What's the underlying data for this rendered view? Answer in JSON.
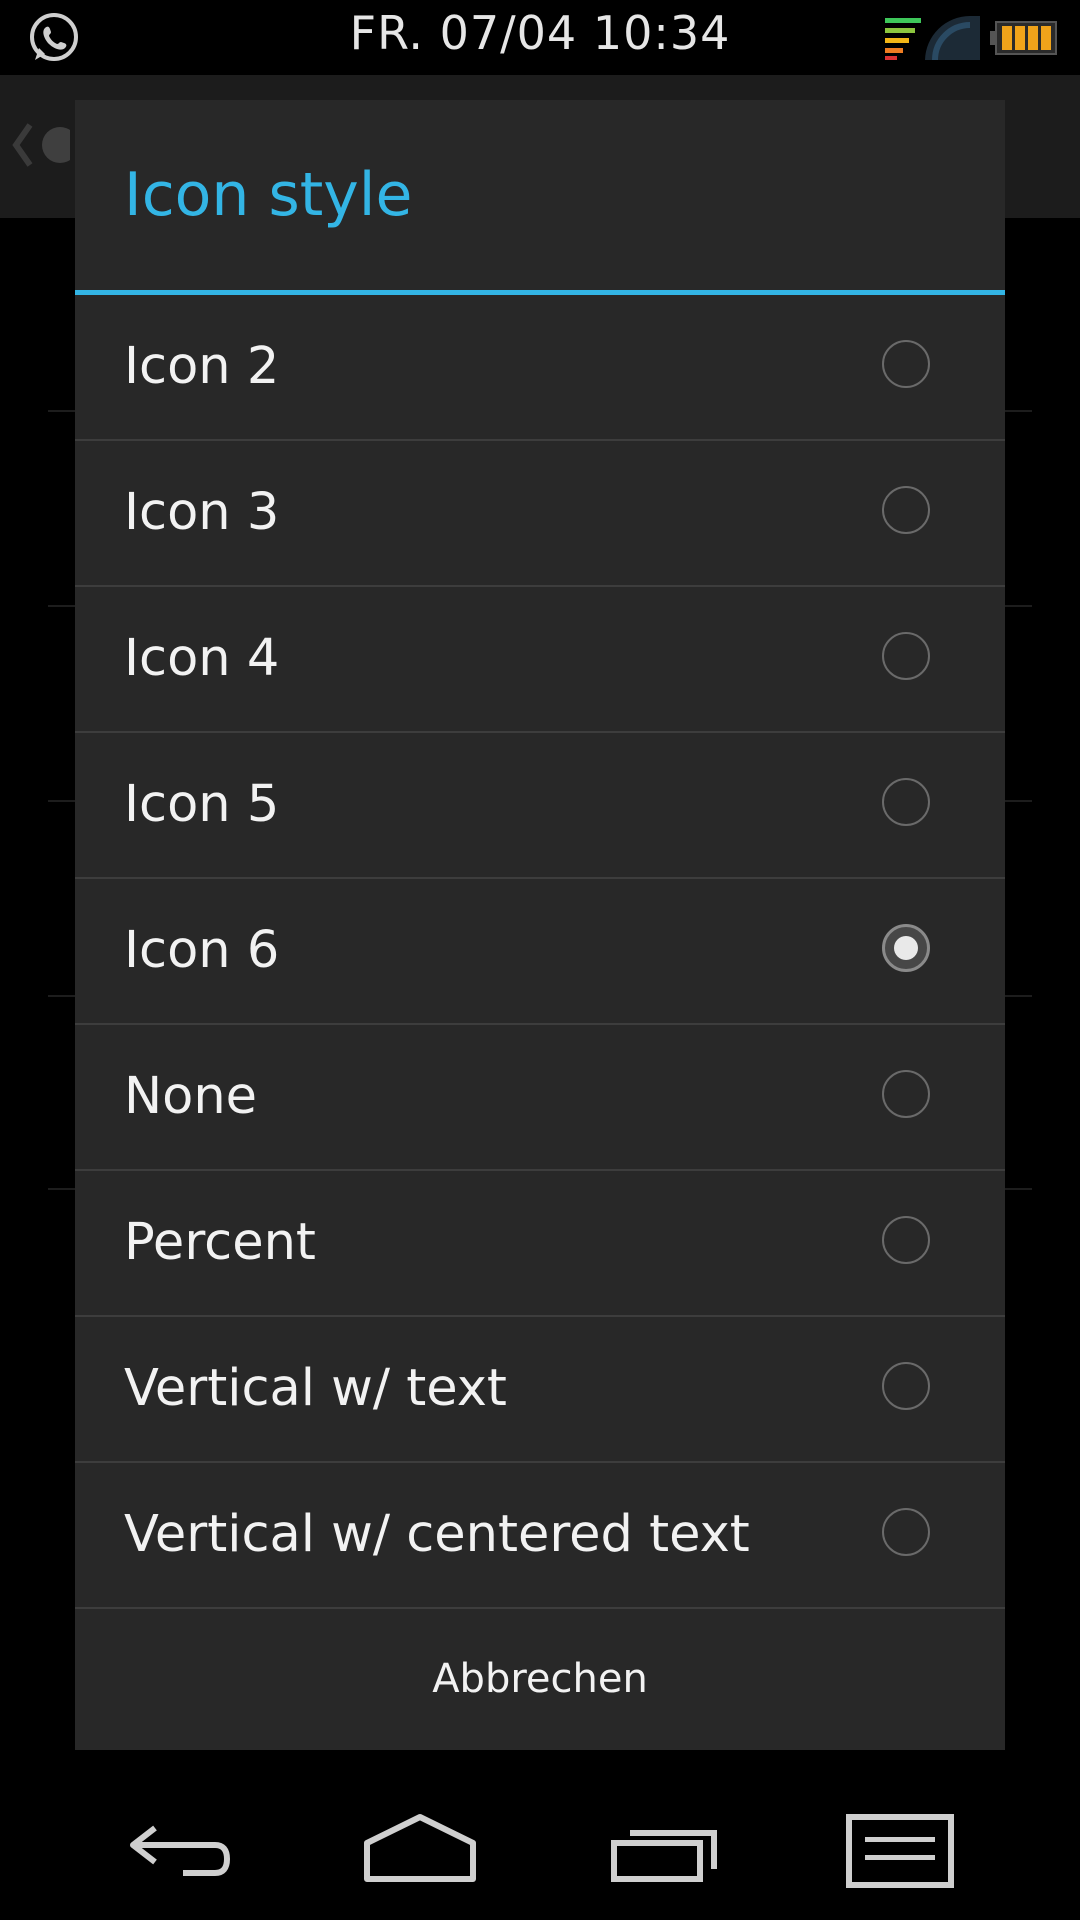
{
  "status_bar": {
    "datetime": "FR. 07/04 10:34",
    "left_icon": "whatsapp-icon",
    "signal_icon": "wifi-signal-icon",
    "battery_icon": "battery-icon"
  },
  "dialog": {
    "title": "Icon style",
    "options": [
      {
        "label": "Icon 2",
        "selected": false
      },
      {
        "label": "Icon 3",
        "selected": false
      },
      {
        "label": "Icon 4",
        "selected": false
      },
      {
        "label": "Icon 5",
        "selected": false
      },
      {
        "label": "Icon 6",
        "selected": true
      },
      {
        "label": "None",
        "selected": false
      },
      {
        "label": "Percent",
        "selected": false
      },
      {
        "label": "Vertical w/ text",
        "selected": false
      },
      {
        "label": "Vertical w/ centered text",
        "selected": false
      }
    ],
    "cancel_label": "Abbrechen"
  },
  "navigation_bar": {
    "back_icon": "back-icon",
    "home_icon": "home-icon",
    "recents_icon": "recent-apps-icon",
    "menu_icon": "menu-icon"
  },
  "colors": {
    "accent": "#33b5e5",
    "dialog_background": "#282828",
    "screen_background": "#000000"
  }
}
